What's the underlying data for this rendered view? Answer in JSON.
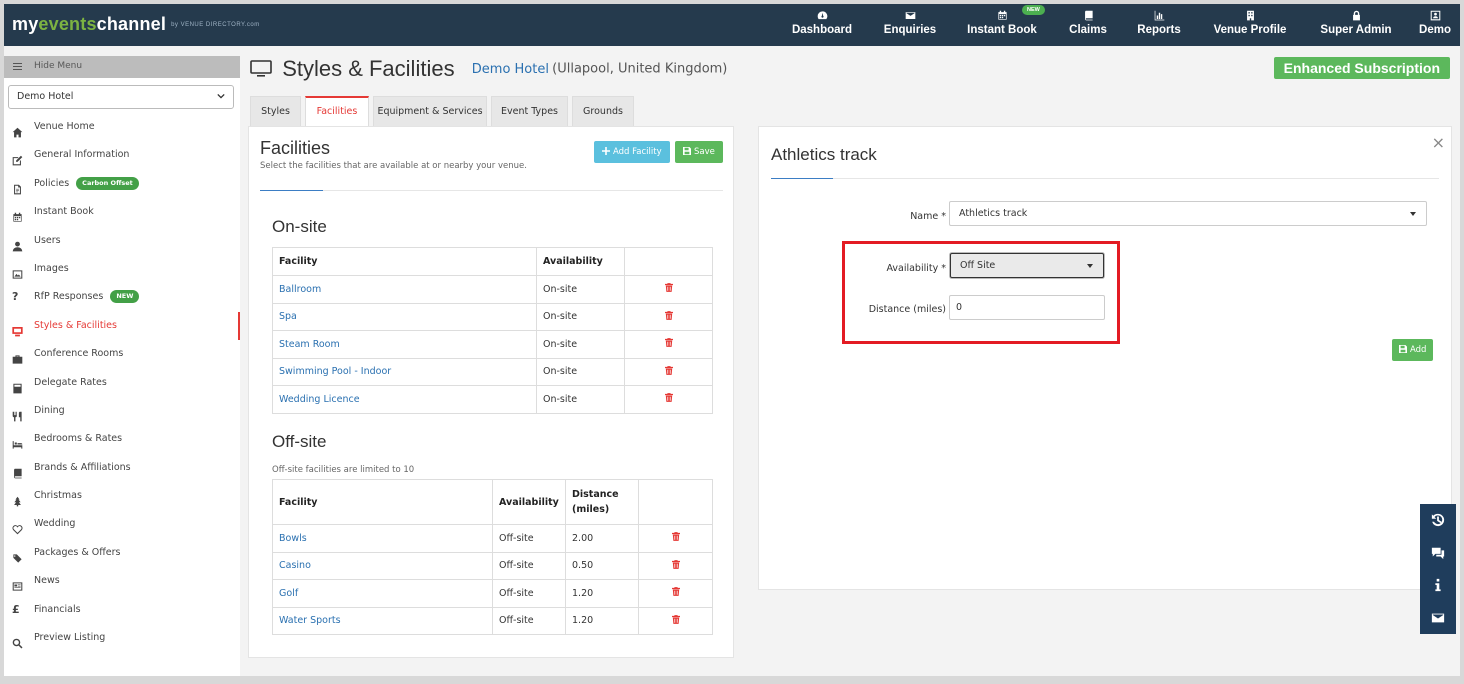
{
  "app": {
    "logo_prefix": "my",
    "logo_highlight": "events",
    "logo_suffix": "channel",
    "logo_by": "by VENUE DIRECTORY.com"
  },
  "topnav": {
    "items": [
      {
        "label": "Dashboard",
        "icon": "dashboard-icon"
      },
      {
        "label": "Enquiries",
        "icon": "envelope-icon"
      },
      {
        "label": "Instant Book",
        "icon": "calendar-icon",
        "badge": "NEW"
      },
      {
        "label": "Claims",
        "icon": "book-icon"
      },
      {
        "label": "Reports",
        "icon": "bar-chart-icon"
      },
      {
        "label": "Venue Profile",
        "icon": "building-icon"
      },
      {
        "label": "Super Admin",
        "icon": "lock-icon"
      },
      {
        "label": "Demo",
        "icon": "user-icon"
      }
    ]
  },
  "sidebar": {
    "hide_menu": "Hide Menu",
    "venue_select": "Demo Hotel",
    "items": [
      {
        "label": "Venue Home"
      },
      {
        "label": "General Information"
      },
      {
        "label": "Policies",
        "badge": "Carbon Offset"
      },
      {
        "label": "Instant Book"
      },
      {
        "label": "Users"
      },
      {
        "label": "Images"
      },
      {
        "label": "RfP Responses",
        "badge": "NEW"
      },
      {
        "label": "Styles & Facilities"
      },
      {
        "label": "Conference Rooms"
      },
      {
        "label": "Delegate Rates"
      },
      {
        "label": "Dining"
      },
      {
        "label": "Bedrooms & Rates"
      },
      {
        "label": "Brands & Affiliations"
      },
      {
        "label": "Christmas"
      },
      {
        "label": "Wedding"
      },
      {
        "label": "Packages & Offers"
      },
      {
        "label": "News"
      },
      {
        "label": "Financials"
      },
      {
        "label": "Preview Listing"
      }
    ]
  },
  "header": {
    "title": "Styles & Facilities",
    "venue_link": "Demo Hotel",
    "location": "(Ullapool, United Kingdom)",
    "subscription": "Enhanced Subscription"
  },
  "tabs": [
    "Styles",
    "Facilities",
    "Equipment & Services",
    "Event Types",
    "Grounds"
  ],
  "facilities": {
    "title": "Facilities",
    "subtitle": "Select the facilities that are available at or nearby your venue.",
    "add_button": "Add Facility",
    "save_button": "Save",
    "onsite": {
      "heading": "On-site",
      "columns": [
        "Facility",
        "Availability"
      ],
      "rows": [
        {
          "facility": "Ballroom",
          "availability": "On-site"
        },
        {
          "facility": "Spa",
          "availability": "On-site"
        },
        {
          "facility": "Steam Room",
          "availability": "On-site"
        },
        {
          "facility": "Swimming Pool - Indoor",
          "availability": "On-site"
        },
        {
          "facility": "Wedding Licence",
          "availability": "On-site"
        }
      ]
    },
    "offsite": {
      "heading": "Off-site",
      "note": "Off-site facilities are limited to 10",
      "columns": [
        "Facility",
        "Availability",
        "Distance",
        "(miles)"
      ],
      "rows": [
        {
          "facility": "Bowls",
          "availability": "Off-site",
          "distance": "2.00"
        },
        {
          "facility": "Casino",
          "availability": "Off-site",
          "distance": "0.50"
        },
        {
          "facility": "Golf",
          "availability": "Off-site",
          "distance": "1.20"
        },
        {
          "facility": "Water Sports",
          "availability": "Off-site",
          "distance": "1.20"
        }
      ]
    }
  },
  "editor": {
    "title": "Athletics track",
    "close": "×",
    "name_label": "Name *",
    "name_value": "Athletics track",
    "availability_label": "Availability *",
    "availability_value": "Off Site",
    "distance_label": "Distance (miles)",
    "distance_value": "0",
    "add_button": "Add"
  },
  "colors": {
    "nav_bg": "#253a4d",
    "accent_red": "#e53935",
    "success_green": "#5cb85c",
    "info_blue": "#5bc0de",
    "link_blue": "#2a70b0",
    "highlight_red": "#e31b23"
  }
}
